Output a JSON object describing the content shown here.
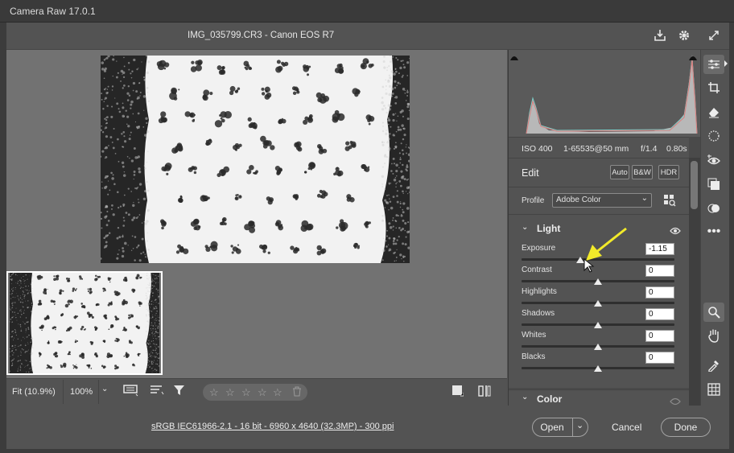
{
  "window": {
    "title": "Camera Raw 17.0.1"
  },
  "header": {
    "file_title": "IMG_035799.CR3  -  Canon EOS R7"
  },
  "bottom_bar": {
    "zoom_fit": "Fit (10.9%)",
    "zoom_100": "100%",
    "rating_stars": [
      "☆",
      "☆",
      "☆",
      "☆",
      "☆"
    ]
  },
  "footer": {
    "workflow_link": "sRGB IEC61966-2.1 - 16 bit - 6960 x 4640 (32.3MP) - 300 ppi",
    "open_label": "Open",
    "cancel_label": "Cancel",
    "done_label": "Done"
  },
  "camera_info": {
    "iso": "ISO 400",
    "lens": "1-65535@50 mm",
    "aperture": "f/1.4",
    "shutter": "0.80s"
  },
  "edit": {
    "heading": "Edit",
    "auto_label": "Auto",
    "bw_label": "B&W",
    "hdr_label": "HDR",
    "profile_label": "Profile",
    "profile_value": "Adobe Color"
  },
  "light": {
    "heading": "Light",
    "sliders": [
      {
        "label": "Exposure",
        "value": "-1.15",
        "level": 0.385
      },
      {
        "label": "Contrast",
        "value": "0",
        "level": 0.5
      },
      {
        "label": "Highlights",
        "value": "0",
        "level": 0.5
      },
      {
        "label": "Shadows",
        "value": "0",
        "level": 0.5
      },
      {
        "label": "Whites",
        "value": "0",
        "level": 0.5
      },
      {
        "label": "Blacks",
        "value": "0",
        "level": 0.5
      }
    ]
  },
  "color": {
    "heading": "Color"
  },
  "icons": {
    "save": "save-icon",
    "settings": "gear-icon",
    "fullscreen": "expand-icon"
  },
  "colors": {
    "accent_arrow": "#f2ea2a"
  }
}
